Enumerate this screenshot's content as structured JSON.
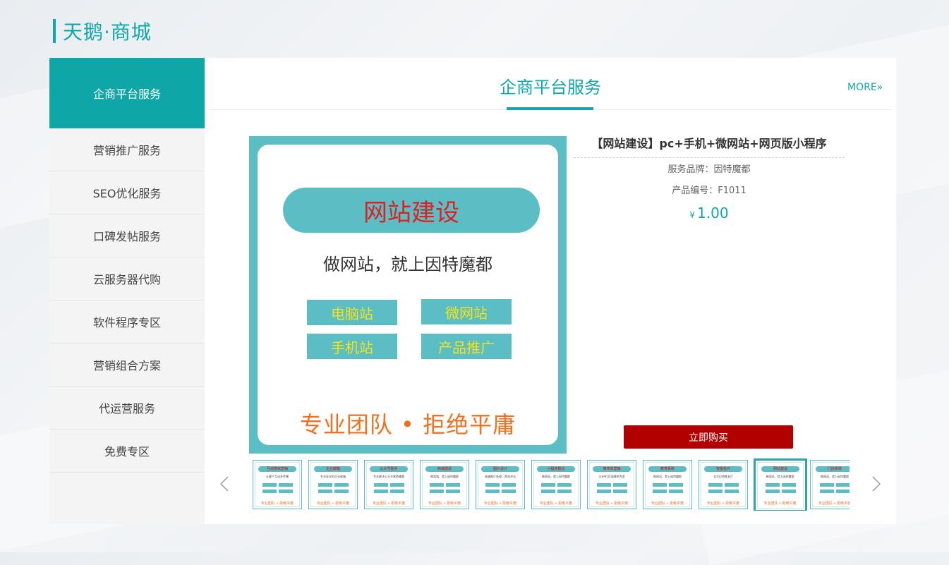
{
  "brand": {
    "title": "天鹅·商城"
  },
  "sidebar": {
    "items": [
      {
        "label": "企商平台服务"
      },
      {
        "label": "营销推广服务"
      },
      {
        "label": "SEO优化服务"
      },
      {
        "label": "口碑发帖服务"
      },
      {
        "label": "云服务器代购"
      },
      {
        "label": "软件程序专区"
      },
      {
        "label": "营销组合方案"
      },
      {
        "label": "代运营服务"
      },
      {
        "label": "免费专区"
      }
    ]
  },
  "panel": {
    "title": "企商平台服务",
    "more_label": "MORE»"
  },
  "main_image": {
    "pill_text": "网站建设",
    "slogan": "做网站，就上因特魔都",
    "boxes": [
      "电脑站",
      "微网站",
      "手机站",
      "产品推广"
    ],
    "tagline": "专业团队 • 拒绝平庸"
  },
  "product": {
    "name": "【网站建设】pc+手机+微网站+网页版小程序",
    "brand_line": "服务品牌：因特魔都",
    "code_line": "产品编号：F1011",
    "currency": "¥",
    "price": "1.00",
    "buy_label": "立即购买"
  },
  "thumbnails": [
    {
      "title": "互动游戏营销",
      "sub": "让客户互动并传播"
    },
    {
      "title": "企业邮箱",
      "sub": "专业安全的企业邮箱"
    },
    {
      "title": "公众号助手",
      "sub": "专业解决公众号营销难题"
    },
    {
      "title": "商城建设",
      "sub": "做商城，就上因特魔都"
    },
    {
      "title": "图片设计",
      "sub": "高端图片处理，视觉冲击"
    },
    {
      "title": "小程序建设",
      "sub": "做网站，就上因特魔都"
    },
    {
      "title": "微传单营销",
      "sub": "企业H5页面营销专家"
    },
    {
      "title": "教育系统",
      "sub": "做网站，就上因特魔都"
    },
    {
      "title": "智能名片",
      "sub": "全方位销售名片"
    },
    {
      "title": "网站建设",
      "sub": "做网站，就上因特魔都"
    },
    {
      "title": "门店系统",
      "sub": "做网站，就上因特魔都"
    }
  ],
  "thumb_tag": "专业团队 • 拒绝平庸",
  "active_thumb": 9,
  "colors": {
    "accent": "#10a7a8",
    "buy": "#b20000",
    "image_bg": "#5bbec5"
  },
  "icons": {
    "prev": "chevron-left-icon",
    "next": "chevron-right-icon"
  }
}
